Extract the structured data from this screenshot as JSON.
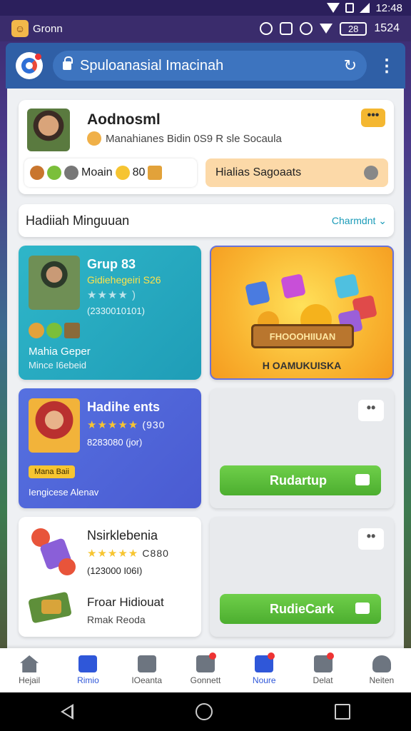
{
  "status_bar": {
    "time": "12:48"
  },
  "app_bar": {
    "app_name": "Gronn",
    "right_pill": "28",
    "right_text": "1524"
  },
  "browser": {
    "url_text": "Spuloanasial Imacinah"
  },
  "profile": {
    "name": "Aodnosml",
    "subtitle": "Manahianes Bidin 0S9 R sle Socaula",
    "stat_label": "Moain",
    "stat_value": "80",
    "bonus_label": "Hialias Sagoaats"
  },
  "weekly": {
    "title": "Hadiiah Minguuan",
    "link": "Charmdnt"
  },
  "tiles": {
    "teal": {
      "title": "Grup 83",
      "subtitle": "Gidiehegeiri S26",
      "stars": "★★★★",
      "count": "(2330010101)",
      "footer_title": "Mahia Geper",
      "footer_sub": "Mince I6ebeid"
    },
    "promo": {
      "sign": "FHOOOHIIUAN",
      "caption": "H OAMUKUISKA"
    },
    "blue": {
      "title": "Hadihe ents",
      "stars": "★★★★★",
      "star_count": "(930",
      "count": "8283080 (jor)",
      "tag": "Mana Baii",
      "footer": "Iengicese Alenav"
    },
    "ghost1": {
      "button": "Rudartup"
    },
    "white": {
      "title": "Nsirklebenia",
      "stars": "★★★★★",
      "star_count": "C880",
      "count": "(123000 I06I)",
      "row2_title": "Froar Hidiouat",
      "row2_sub": "Rmak Reoda"
    },
    "ghost2": {
      "button": "RudieCark"
    }
  },
  "bottom_nav": [
    {
      "label": "Hejail"
    },
    {
      "label": "Rimio"
    },
    {
      "label": "IOeanta"
    },
    {
      "label": "Gonnett"
    },
    {
      "label": "Noure"
    },
    {
      "label": "Delat"
    },
    {
      "label": "Neiten"
    }
  ],
  "colors": {
    "accent_blue": "#2f57d9",
    "teal": "#1f9db7",
    "green": "#4cae2f",
    "gold": "#f4b731"
  }
}
